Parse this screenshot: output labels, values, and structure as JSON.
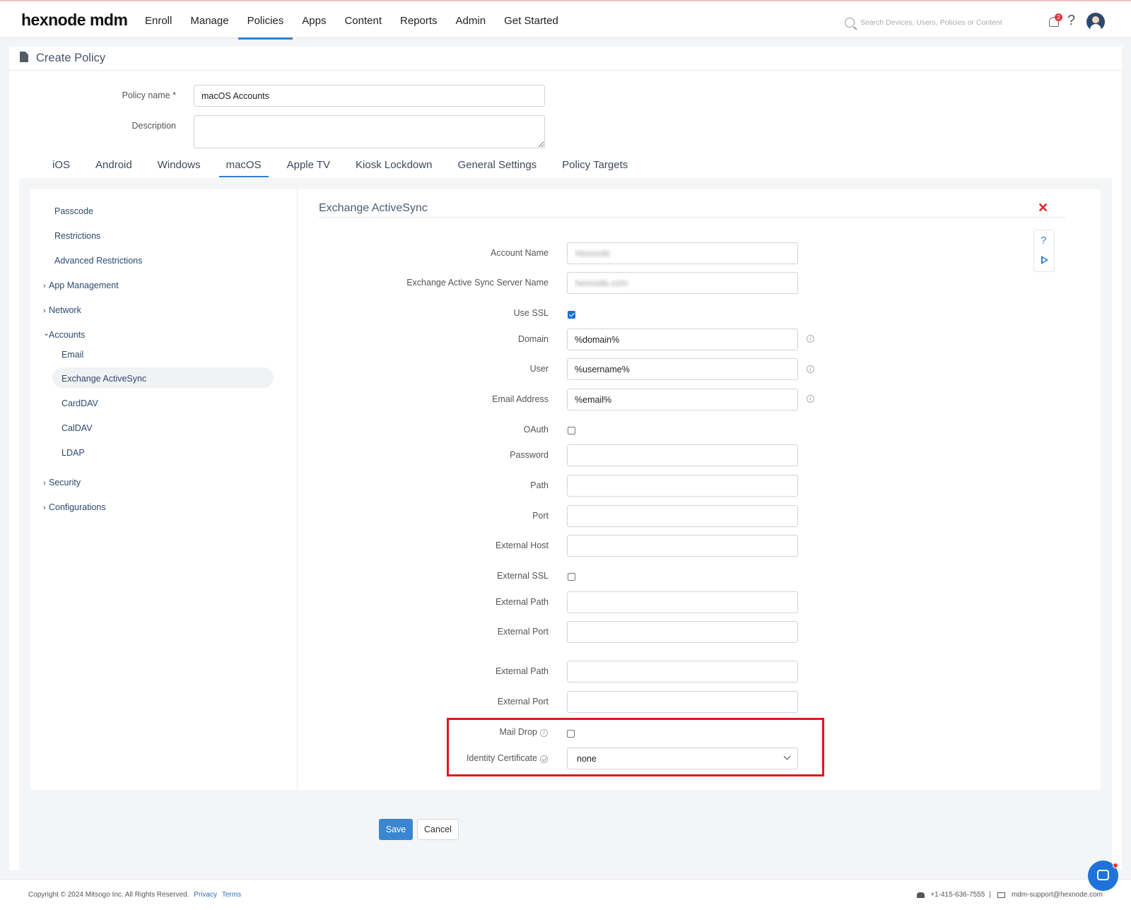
{
  "app": {
    "logo": "hexnode mdm"
  },
  "nav": {
    "items": [
      "Enroll",
      "Manage",
      "Policies",
      "Apps",
      "Content",
      "Reports",
      "Admin",
      "Get Started"
    ],
    "active": "Policies"
  },
  "search": {
    "placeholder": "Search Devices, Users, Policies or Content",
    "icon": "search-icon"
  },
  "notifications": {
    "count": "2"
  },
  "page": {
    "title": "Create Policy"
  },
  "policy": {
    "name_label": "Policy name *",
    "name_value": "macOS Accounts",
    "description_label": "Description",
    "description_value": ""
  },
  "os_tabs": {
    "items": [
      "iOS",
      "Android",
      "Windows",
      "macOS",
      "Apple TV",
      "Kiosk Lockdown",
      "General Settings",
      "Policy Targets"
    ],
    "active": "macOS"
  },
  "sidebar": {
    "items": [
      {
        "label": "Passcode",
        "chevron": ""
      },
      {
        "label": "Restrictions",
        "chevron": ""
      },
      {
        "label": "Advanced Restrictions",
        "chevron": ""
      },
      {
        "label": "App Management",
        "chevron": "›"
      },
      {
        "label": "Network",
        "chevron": "›"
      },
      {
        "label": "Accounts",
        "chevron": "⌄"
      },
      {
        "label": "Email",
        "chevron": ""
      },
      {
        "label": "Exchange ActiveSync",
        "chevron": ""
      },
      {
        "label": "CardDAV",
        "chevron": ""
      },
      {
        "label": "CalDAV",
        "chevron": ""
      },
      {
        "label": "LDAP",
        "chevron": ""
      },
      {
        "label": "Security",
        "chevron": "›"
      },
      {
        "label": "Configurations",
        "chevron": "›"
      }
    ],
    "active": "Exchange ActiveSync"
  },
  "section": {
    "title": "Exchange ActiveSync"
  },
  "form": {
    "account_name": {
      "label": "Account Name",
      "value": "Hexnode"
    },
    "server_name": {
      "label": "Exchange Active Sync Server Name",
      "value": "hexnode.com"
    },
    "use_ssl": {
      "label": "Use SSL",
      "checked": true
    },
    "domain": {
      "label": "Domain",
      "value": "%domain%"
    },
    "user": {
      "label": "User",
      "value": "%username%"
    },
    "email": {
      "label": "Email Address",
      "value": "%email%"
    },
    "oauth": {
      "label": "OAuth",
      "checked": false
    },
    "password": {
      "label": "Password",
      "value": ""
    },
    "path": {
      "label": "Path",
      "value": ""
    },
    "port": {
      "label": "Port",
      "value": ""
    },
    "external_host": {
      "label": "External Host",
      "value": ""
    },
    "external_ssl": {
      "label": "External SSL",
      "checked": false
    },
    "external_path_1": {
      "label": "External Path",
      "value": ""
    },
    "external_port_1": {
      "label": "External Port",
      "value": ""
    },
    "external_path_2": {
      "label": "External Path",
      "value": ""
    },
    "external_port_2": {
      "label": "External Port",
      "value": ""
    },
    "mail_drop": {
      "label": "Mail Drop",
      "checked": false
    },
    "identity_certificate": {
      "label": "Identity Certificate",
      "value": "none"
    }
  },
  "buttons": {
    "save": "Save",
    "cancel": "Cancel"
  },
  "footer": {
    "copyright": "Copyright © 2024 Mitsogo Inc. All Rights Reserved.",
    "privacy": "Privacy",
    "terms": "Terms",
    "phone": "+1-415-636-7555",
    "separator": "|",
    "email": "mdm-support@hexnode.com"
  },
  "colors": {
    "accent": "#2f7fd1",
    "highlight": "#e01818",
    "save": "#3a86d1"
  }
}
